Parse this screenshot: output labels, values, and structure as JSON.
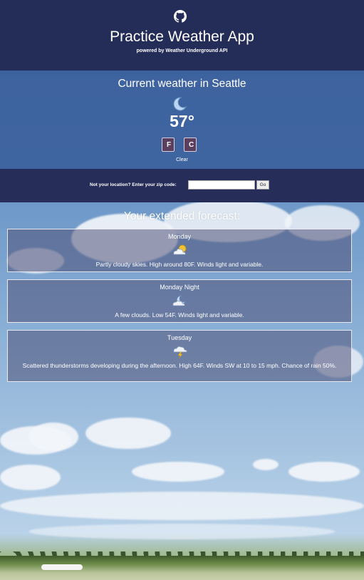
{
  "header": {
    "icon": "github-icon",
    "title": "Practice Weather App",
    "subtitle": "powered by Weather Underground API"
  },
  "current": {
    "heading": "Current weather in Seattle",
    "icon": "moon-icon",
    "temperature": "57°",
    "unit_f": "F",
    "unit_c": "C",
    "clear_label": "Clear"
  },
  "zip": {
    "label": "Not your location? Enter your zip code:",
    "value": "",
    "go_label": "Go"
  },
  "forecast": {
    "heading": "Your extended forecast:",
    "days": [
      {
        "day": "Monday",
        "icon": "partly-cloudy-icon",
        "text": "Partly cloudy skies. High around 80F. Winds light and variable."
      },
      {
        "day": "Monday Night",
        "icon": "night-clouds-icon",
        "text": "A few clouds. Low 54F. Winds light and variable."
      },
      {
        "day": "Tuesday",
        "icon": "thunderstorm-icon",
        "text": "Scattered thunderstorms developing during the afternoon. High 64F. Winds SW at 10 to 15 mph. Chance of rain 50%."
      }
    ]
  },
  "colors": {
    "header_bg": "#242c58",
    "current_bg": "#3a5f9b",
    "unit_button_bg": "#5a3f5f"
  }
}
